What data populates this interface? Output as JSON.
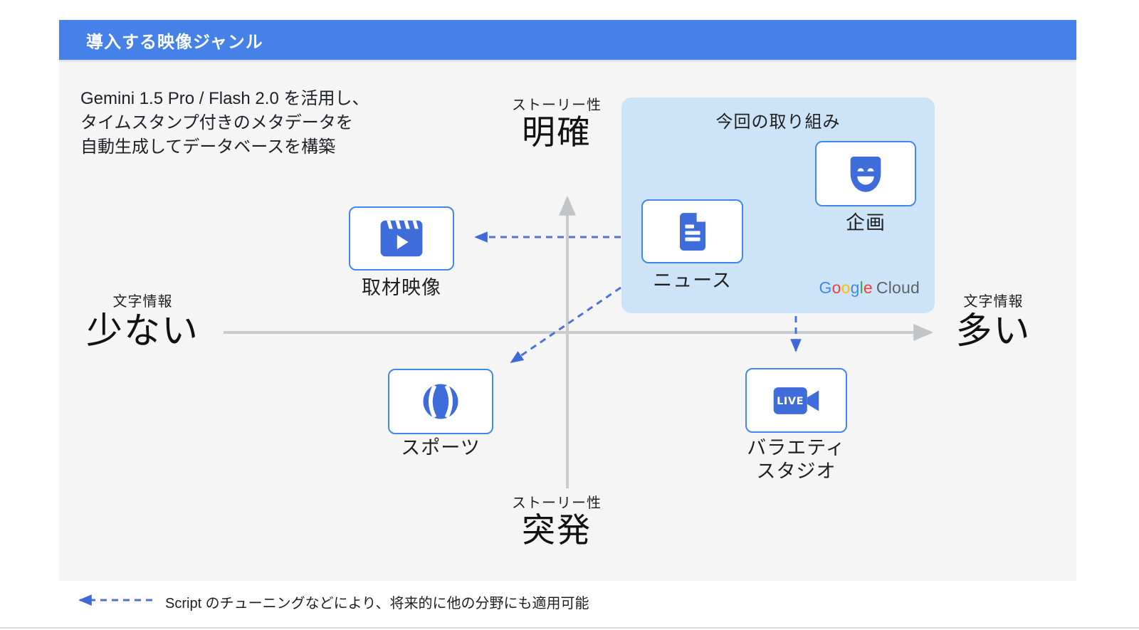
{
  "header": {
    "title": "導入する映像ジャンル",
    "bg_color": "#4581E8"
  },
  "intro": {
    "lines": [
      "Gemini 1.5 Pro / Flash 2.0 を活用し、",
      "タイムスタンプ付きのメタデータを",
      "自動生成してデータベースを構築"
    ]
  },
  "axes": {
    "top": {
      "small": "ストーリー性",
      "large": "明確"
    },
    "bottom": {
      "small": "ストーリー性",
      "large": "突発"
    },
    "left": {
      "small": "文字情報",
      "large": "少ない"
    },
    "right": {
      "small": "文字情報",
      "large": "多い"
    }
  },
  "highlight": {
    "title": "今回の取り組み",
    "bg_color": "#CDE4F8"
  },
  "items": {
    "kikaku": {
      "label": "企画",
      "icon": "theater-mask-icon"
    },
    "news": {
      "label": "ニュース",
      "icon": "document-icon"
    },
    "shuzai": {
      "label": "取材映像",
      "icon": "movie-clapper-icon"
    },
    "sports": {
      "label": "スポーツ",
      "icon": "tennis-ball-icon"
    },
    "variety": {
      "label_line1": "バラエティ",
      "label_line2": "スタジオ",
      "icon": "live-camera-icon",
      "badge": "LIVE"
    }
  },
  "logo": {
    "letters": [
      {
        "ch": "G",
        "color": "#4285F4"
      },
      {
        "ch": "o",
        "color": "#EA4335"
      },
      {
        "ch": "o",
        "color": "#FBBC05"
      },
      {
        "ch": "g",
        "color": "#4285F4"
      },
      {
        "ch": "l",
        "color": "#34A853"
      },
      {
        "ch": "e",
        "color": "#EA4335"
      }
    ],
    "cloud": "Cloud"
  },
  "legend": {
    "text": "Script のチューニングなどにより、将来的に他の分野にも適用可能"
  },
  "colors": {
    "icon_blue": "#3E6CDB",
    "card_border": "#4285F4",
    "dashed_arrow_blue": "#4C72D9",
    "axis_gray": "#C9CBCD",
    "canvas_bg": "#F5F5F6",
    "text": "#202124",
    "cloud_gray": "#5F6368"
  }
}
